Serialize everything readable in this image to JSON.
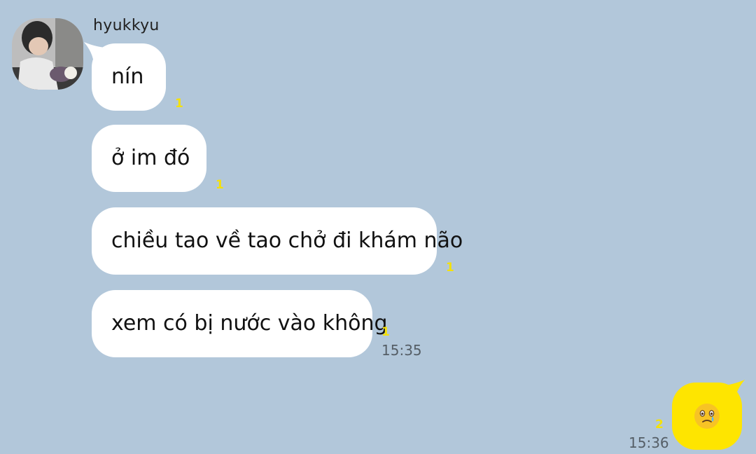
{
  "sender": {
    "name": "hyukkyu"
  },
  "messages": [
    {
      "text": "nín",
      "unread": "1"
    },
    {
      "text": "ở im đó",
      "unread": "1"
    },
    {
      "text": "chiều tao về tao chở đi khám não",
      "unread": "1"
    },
    {
      "text": "xem có bị nước vào không",
      "unread": "1",
      "time": "15:35"
    }
  ],
  "my_message": {
    "emoji": "face-holding-back-tears-emoji",
    "unread": "2",
    "time": "15:36"
  },
  "colors": {
    "background": "#b2c7da",
    "incoming_bubble": "#ffffff",
    "outgoing_bubble": "#fee500",
    "unread_count": "#f4e10a",
    "time": "#555e66"
  }
}
